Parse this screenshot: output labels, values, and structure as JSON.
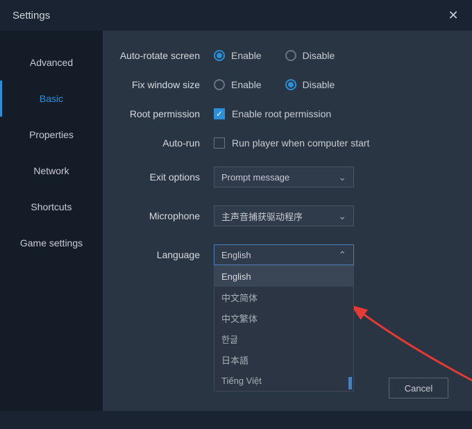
{
  "window": {
    "title": "Settings"
  },
  "sidebar": {
    "tabs": [
      {
        "label": "Advanced"
      },
      {
        "label": "Basic"
      },
      {
        "label": "Properties"
      },
      {
        "label": "Network"
      },
      {
        "label": "Shortcuts"
      },
      {
        "label": "Game settings"
      }
    ],
    "activeIndex": 1
  },
  "settings": {
    "autoRotate": {
      "label": "Auto-rotate screen",
      "enable": "Enable",
      "disable": "Disable"
    },
    "fixWindow": {
      "label": "Fix window size",
      "enable": "Enable",
      "disable": "Disable"
    },
    "root": {
      "label": "Root permission",
      "checkLabel": "Enable root permission"
    },
    "autorun": {
      "label": "Auto-run",
      "checkLabel": "Run player when computer start"
    },
    "exit": {
      "label": "Exit options",
      "value": "Prompt message"
    },
    "mic": {
      "label": "Microphone",
      "value": "主声音捕获驱动程序"
    },
    "lang": {
      "label": "Language",
      "value": "English",
      "options": [
        "English",
        "中文简体",
        "中文繁体",
        "한글",
        "日本語",
        "Tiếng Việt"
      ]
    }
  },
  "buttons": {
    "cancel": "Cancel"
  }
}
